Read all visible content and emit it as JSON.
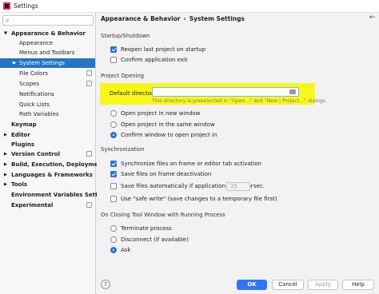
{
  "window": {
    "title": "Settings"
  },
  "search": {
    "placeholder": ""
  },
  "sidebar": {
    "items": [
      {
        "label": "Appearance & Behavior",
        "arrow": "▼"
      },
      {
        "label": "Appearance"
      },
      {
        "label": "Menus and Toolbars"
      },
      {
        "label": "System Settings",
        "arrow": "▶"
      },
      {
        "label": "File Colors"
      },
      {
        "label": "Scopes"
      },
      {
        "label": "Notifications"
      },
      {
        "label": "Quick Lists"
      },
      {
        "label": "Path Variables"
      },
      {
        "label": "Keymap"
      },
      {
        "label": "Editor",
        "arrow": "▶"
      },
      {
        "label": "Plugins"
      },
      {
        "label": "Version Control",
        "arrow": "▶"
      },
      {
        "label": "Build, Execution, Deployment",
        "arrow": "▶"
      },
      {
        "label": "Languages & Frameworks",
        "arrow": "▶"
      },
      {
        "label": "Tools",
        "arrow": "▶"
      },
      {
        "label": "Environment Variables Settings"
      },
      {
        "label": "Experimental"
      }
    ]
  },
  "breadcrumb": {
    "parent": "Appearance & Behavior",
    "separator": "›",
    "current": "System Settings"
  },
  "startup": {
    "title": "Startup/Shutdown",
    "reopen_label": "Reopen last project on startup",
    "reopen_checked": true,
    "confirm_exit_label": "Confirm application exit",
    "confirm_exit_checked": false
  },
  "project_opening": {
    "title": "Project Opening",
    "default_dir_label": "Default directory:",
    "default_dir_value": "",
    "hint": "This directory is preselected in \"Open...\" and \"New | Project...\" dialogs.",
    "options": [
      {
        "label": "Open project in new window",
        "checked": false
      },
      {
        "label": "Open project in the same window",
        "checked": false
      },
      {
        "label": "Confirm window to open project in",
        "checked": true
      }
    ]
  },
  "synchronization": {
    "title": "Synchronization",
    "sync_label": "Synchronize files on frame or editor tab activation",
    "sync_checked": true,
    "save_deactivation_label": "Save files on frame deactivation",
    "save_deactivation_checked": true,
    "save_idle_label": "Save files automatically if application is idle for",
    "save_idle_checked": false,
    "idle_seconds": "15",
    "idle_unit": "sec.",
    "safe_write_label": "Use \"safe write\" (save changes to a temporary file first)",
    "safe_write_checked": false
  },
  "closing": {
    "title": "On Closing Tool Window with Running Process",
    "options": [
      {
        "label": "Terminate process",
        "checked": false
      },
      {
        "label": "Disconnect (if available)",
        "checked": false
      },
      {
        "label": "Ask",
        "checked": true
      }
    ]
  },
  "buttons": {
    "help": "?",
    "ok": "OK",
    "cancel": "Cancel",
    "apply": "Apply",
    "help_text": "Help"
  },
  "colors": {
    "accent": "#3574f0",
    "selection": "#2675bf",
    "highlight": "#f7f71e"
  }
}
